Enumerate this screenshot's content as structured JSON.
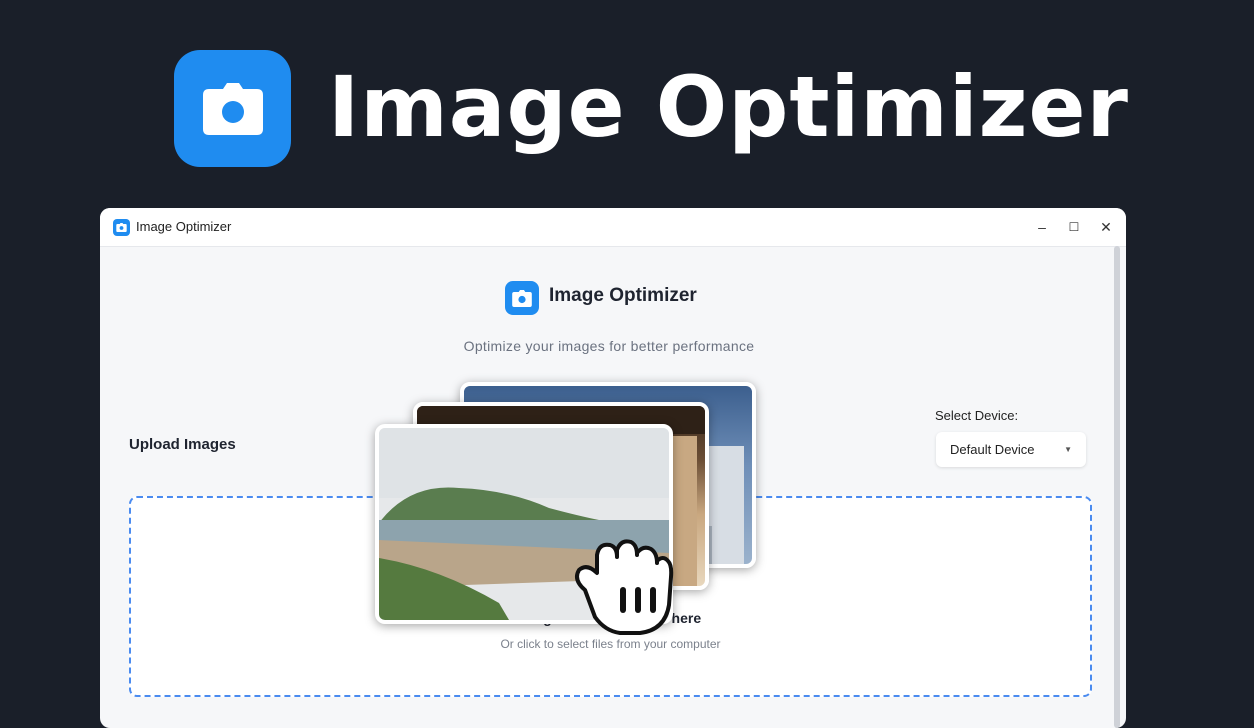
{
  "hero": {
    "title": "Image Optimizer",
    "icon": "camera-icon",
    "accent": "#1f8cf0"
  },
  "window": {
    "title": "Image Optimizer",
    "controls": {
      "minimize": "–",
      "maximize": "☐",
      "close": "✕"
    }
  },
  "app": {
    "title": "Image Optimizer",
    "subtitle": "Optimize your images for better performance",
    "upload_label": "Upload Images",
    "device": {
      "label": "Select Device:",
      "selected": "Default Device"
    },
    "dropzone": {
      "main": "Drag and drop images here",
      "sub": "Or click to select files from your computer"
    }
  }
}
